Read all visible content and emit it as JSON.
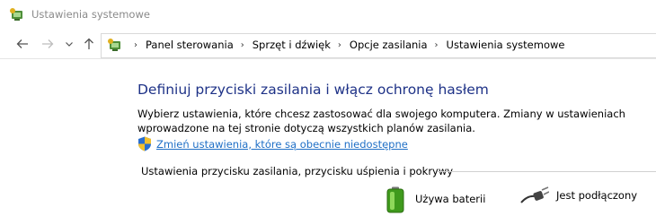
{
  "window": {
    "title": "Ustawienia systemowe"
  },
  "nav": {
    "back": "←",
    "forward": "→",
    "recent": "⌄",
    "up": "↑"
  },
  "breadcrumb": {
    "items": [
      "Panel sterowania",
      "Sprzęt i dźwięk",
      "Opcje zasilania",
      "Ustawienia systemowe"
    ],
    "separator": "›"
  },
  "main": {
    "heading": "Definiuj przyciski zasilania i włącz ochronę hasłem",
    "description": "Wybierz ustawienia, które chcesz zastosować dla swojego komputera. Zmiany w ustawieniach wprowadzone na tej stronie dotyczą wszystkich planów zasilania.",
    "change_link": "Zmień ustawienia, które są obecnie niedostępne",
    "section_title": "Ustawienia przycisku zasilania, przycisku uśpienia i pokrywy",
    "columns": [
      {
        "label": "Używa baterii",
        "icon": "battery-icon"
      },
      {
        "label": "Jest podłączony",
        "icon": "power-plug-icon"
      }
    ]
  },
  "colors": {
    "heading": "#1e3287",
    "link": "#1f6fc6",
    "title_text": "#8a8a8a"
  }
}
